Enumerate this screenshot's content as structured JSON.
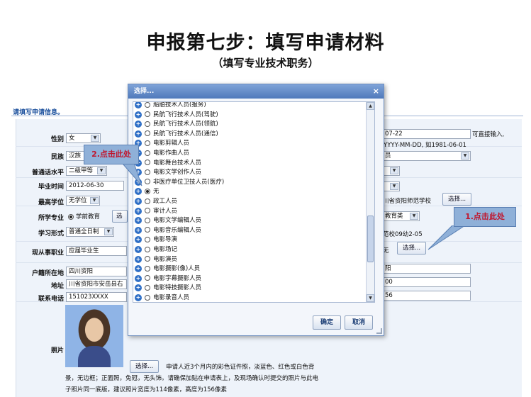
{
  "slide": {
    "title": "申报第七步：填写申请材料",
    "subtitle": "（填写专业技术职务）"
  },
  "form": {
    "header": "请填写申请信息。",
    "gender": {
      "label": "性别",
      "value": "女"
    },
    "ethnicity": {
      "label": "民族",
      "value": "汉族"
    },
    "mandarin": {
      "label": "普通话水平",
      "value": "二级甲等"
    },
    "graduation_date": {
      "label": "毕业时间",
      "value": "2012-06-30"
    },
    "degree": {
      "label": "最高学位",
      "value": "无学位"
    },
    "major": {
      "label": "所学专业",
      "value": "学前教育",
      "button": "选"
    },
    "study_mode": {
      "label": "学习形式",
      "value": "普通全日制"
    },
    "current_job": {
      "label": "现从事职业",
      "value": "应届毕业生"
    },
    "household": {
      "label": "户籍所在地",
      "value": "四川资阳"
    },
    "address": {
      "label": "地址",
      "value": "川省资阳市安岳县右"
    },
    "phone": {
      "label": "联系电话",
      "value": "151023XXXX"
    },
    "photo": {
      "label": "照片",
      "button": "选择...",
      "instructions": "申请人近3个月内的彩色证件照，淡蓝色、红色或白色背景，无边框；正面照，免冠，无头饰。请确保加贴在申请表上，及现场确认时提交的照片与此电子照片同一底版，建议照片宽度为114像素，高度为156像素"
    },
    "right": {
      "date_partial": "07-22",
      "can_input": "可直接输入,",
      "date_format_hint": "YYYY-MM-DD, 如1981-06-01",
      "job_partial": "员",
      "school": "川省资阳师范学校",
      "school_button": "选择...",
      "education_partial": "教育类",
      "cert_partial": "范校09幼2-05",
      "tech_title_value": "无",
      "tech_title_button": "选择...",
      "household_partial": "阳",
      "address_partial": "00",
      "phone_partial": "56"
    }
  },
  "dialog": {
    "title": "选择...",
    "close": "×",
    "items": [
      {
        "label": "船舶技术人员(报务)",
        "selected": false
      },
      {
        "label": "民航飞行技术人员(驾驶)",
        "selected": false
      },
      {
        "label": "民航飞行技术人员(领航)",
        "selected": false
      },
      {
        "label": "民航飞行技术人员(通信)",
        "selected": false
      },
      {
        "label": "电影剪辑人员",
        "selected": false
      },
      {
        "label": "电影作曲人员",
        "selected": false
      },
      {
        "label": "电影舞台技术人员",
        "selected": false
      },
      {
        "label": "电影文学创作人员",
        "selected": false
      },
      {
        "label": "非医疗单位卫技人员(医疗)",
        "selected": false
      },
      {
        "label": "无",
        "selected": true
      },
      {
        "label": "政工人员",
        "selected": false
      },
      {
        "label": "审计人员",
        "selected": false
      },
      {
        "label": "电影文学编辑人员",
        "selected": false
      },
      {
        "label": "电影音乐编辑人员",
        "selected": false
      },
      {
        "label": "电影导演",
        "selected": false
      },
      {
        "label": "电影场记",
        "selected": false
      },
      {
        "label": "电影演员",
        "selected": false
      },
      {
        "label": "电影摄影(像)人员",
        "selected": false
      },
      {
        "label": "电影字幕摄影人员",
        "selected": false
      },
      {
        "label": "电影特技摄影人员",
        "selected": false
      },
      {
        "label": "电影录音人员",
        "selected": false
      }
    ],
    "ok": "确定",
    "cancel": "取消"
  },
  "callouts": {
    "step1": "1.点击此处",
    "step2": "2.点击此处"
  }
}
